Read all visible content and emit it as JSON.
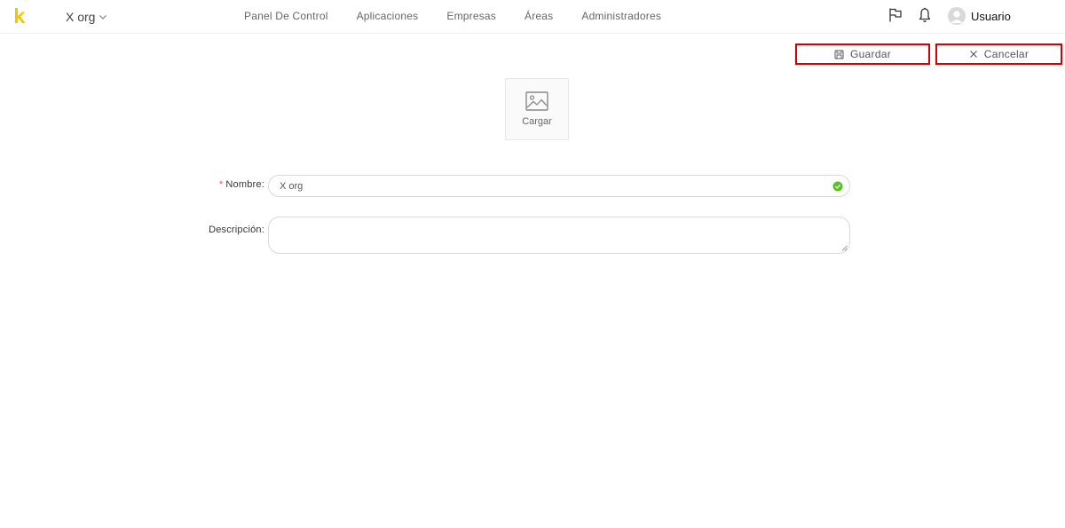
{
  "header": {
    "org_name": "X org",
    "nav": [
      {
        "label": "Panel De Control"
      },
      {
        "label": "Aplicaciones"
      },
      {
        "label": "Empresas"
      },
      {
        "label": "Áreas"
      },
      {
        "label": "Administradores"
      }
    ],
    "user_name": "Usuario",
    "icons": {
      "logo": "k-logo",
      "org": "chevron-down-icon",
      "flag": "flag-icon",
      "bell": "bell-icon",
      "avatar": "user-avatar-icon"
    },
    "logo_color": "#f5c400"
  },
  "actions": {
    "save_label": "Guardar",
    "cancel_label": "Cancelar",
    "highlight_color": "#d60000"
  },
  "upload": {
    "label": "Cargar",
    "icon": "image-icon"
  },
  "form": {
    "name_label": "Nombre",
    "name_required": "*",
    "name_value": "X org",
    "name_valid_color": "#52c41a",
    "description_label": "Descripción",
    "description_value": "",
    "label_suffix": ":"
  }
}
